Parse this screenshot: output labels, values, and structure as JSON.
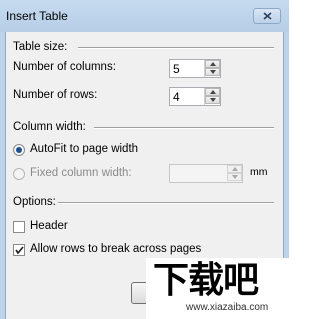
{
  "window": {
    "title": "Insert Table"
  },
  "table_size": {
    "group_label": "Table size:",
    "columns_label": "Number of columns:",
    "columns_value": "5",
    "rows_label": "Number of rows:",
    "rows_value": "4"
  },
  "column_width": {
    "group_label": "Column width:",
    "autofit_label": "AutoFit to page width",
    "autofit_selected": true,
    "fixed_label": "Fixed column width:",
    "fixed_value": "",
    "unit": "mm"
  },
  "options": {
    "group_label": "Options:",
    "header_label": "Header",
    "header_checked": false,
    "break_rows_label": "Allow rows to break across pages",
    "break_rows_checked": true
  },
  "watermark": {
    "logo": "下载吧",
    "url": "www.xiazaiba.com"
  }
}
